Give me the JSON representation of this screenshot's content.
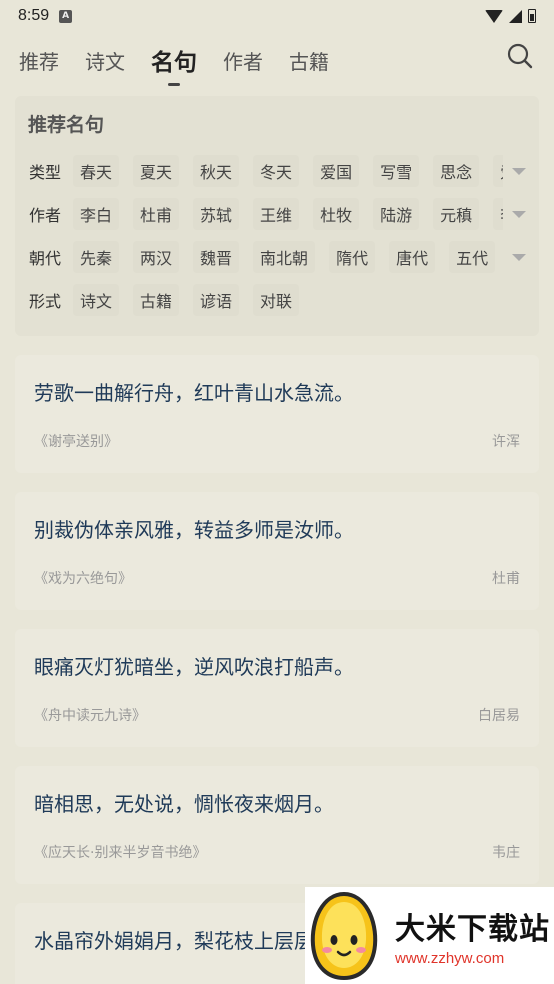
{
  "status": {
    "time": "8:59",
    "badge": "A"
  },
  "tabs": [
    {
      "label": "推荐"
    },
    {
      "label": "诗文"
    },
    {
      "label": "名句",
      "active": true
    },
    {
      "label": "作者"
    },
    {
      "label": "古籍"
    }
  ],
  "search_icon": "search-icon",
  "filter": {
    "title": "推荐名句",
    "rows": [
      {
        "label": "类型",
        "chips": [
          "春天",
          "夏天",
          "秋天",
          "冬天",
          "爱国",
          "写雪",
          "思念",
          "爱"
        ]
      },
      {
        "label": "作者",
        "chips": [
          "李白",
          "杜甫",
          "苏轼",
          "王维",
          "杜牧",
          "陆游",
          "元稹",
          "李"
        ]
      },
      {
        "label": "朝代",
        "chips": [
          "先秦",
          "两汉",
          "魏晋",
          "南北朝",
          "隋代",
          "唐代",
          "五代"
        ]
      },
      {
        "label": "形式",
        "chips": [
          "诗文",
          "古籍",
          "谚语",
          "对联"
        ]
      }
    ]
  },
  "quotes": [
    {
      "text": "劳歌一曲解行舟，红叶青山水急流。",
      "source": "《谢亭送别》",
      "author": "许浑"
    },
    {
      "text": "别裁伪体亲风雅，转益多师是汝师。",
      "source": "《戏为六绝句》",
      "author": "杜甫"
    },
    {
      "text": "眼痛灭灯犹暗坐，逆风吹浪打船声。",
      "source": "《舟中读元九诗》",
      "author": "白居易"
    },
    {
      "text": "暗相思，无处说，惆怅夜来烟月。",
      "source": "《应天长·别来半岁音书绝》",
      "author": "韦庄"
    },
    {
      "text": "水晶帘外娟娟月，梨花枝上层层雪。",
      "source": "",
      "author": ""
    }
  ],
  "watermark": {
    "title": "大米下载站",
    "url": "www.zzhyw.com"
  },
  "colors": {
    "background": "#e8e6d8",
    "card": "#ebe9dd",
    "quote_text": "#1f3a58",
    "watermark_url": "#e0352b"
  }
}
